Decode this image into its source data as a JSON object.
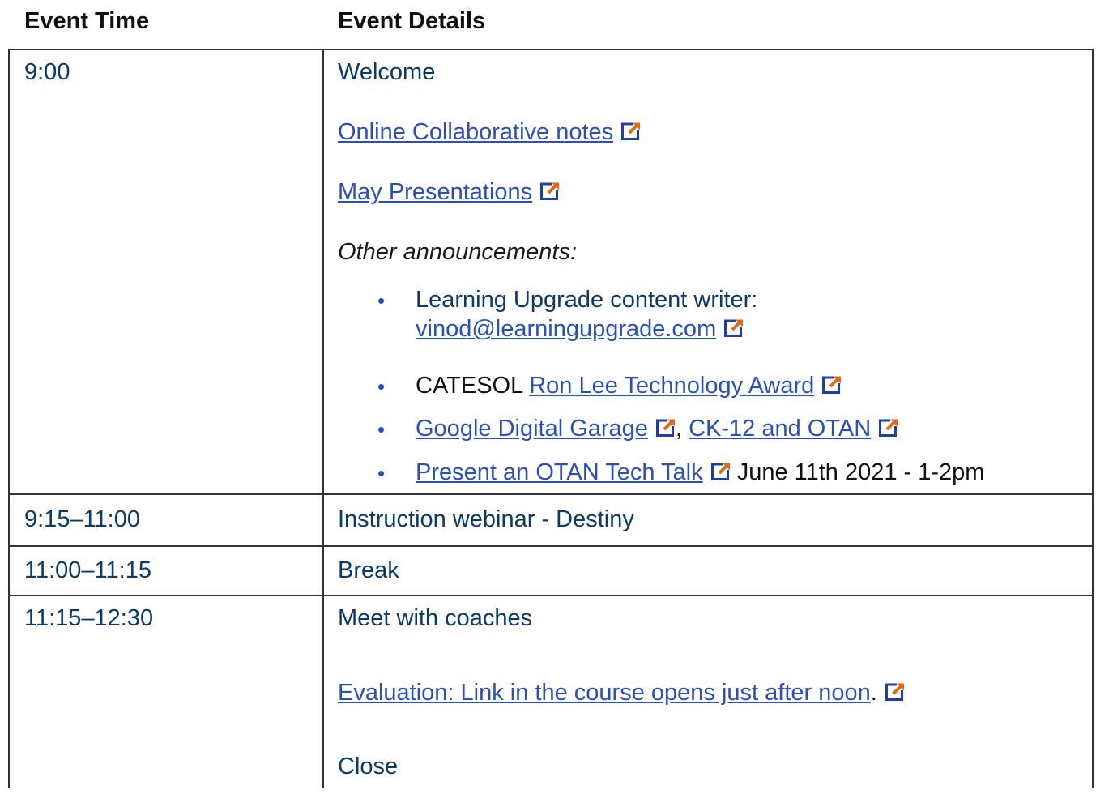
{
  "header": {
    "time_label": "Event Time",
    "details_label": "Event Details"
  },
  "rows": [
    {
      "time": "9:00",
      "title": "Welcome",
      "link_collab": "Online Collaborative notes",
      "link_may": "May Presentations",
      "other_label": "Other announcements:",
      "bullets": {
        "b1_text": "Learning Upgrade content writer:",
        "b1_link": "vinod@learningupgrade.com",
        "b2_text": "CATESOL",
        "b2_link": "Ron Lee Technology Award",
        "b3_link1": "Google Digital Garage",
        "b3_sep": ",",
        "b3_link2": "CK-12 and OTAN",
        "b4_link": "Present an OTAN Tech Talk",
        "b4_text": "June 11th 2021 - 1-2pm"
      }
    },
    {
      "time": "9:15–11:00",
      "title": "Instruction webinar - Destiny"
    },
    {
      "time": "11:00–11:15",
      "title": "Break"
    },
    {
      "time": "11:15–12:30",
      "title": "Meet with coaches",
      "eval_link": "Evaluation: Link in the course opens just after noon",
      "eval_dot": ".",
      "close": "Close"
    }
  ],
  "icons": {
    "external": "external-link-icon"
  },
  "colors": {
    "text": "#0b3a66",
    "link": "#2b4fb5",
    "icon_frame": "#1f3fa8",
    "icon_arrow": "#e06a10"
  }
}
